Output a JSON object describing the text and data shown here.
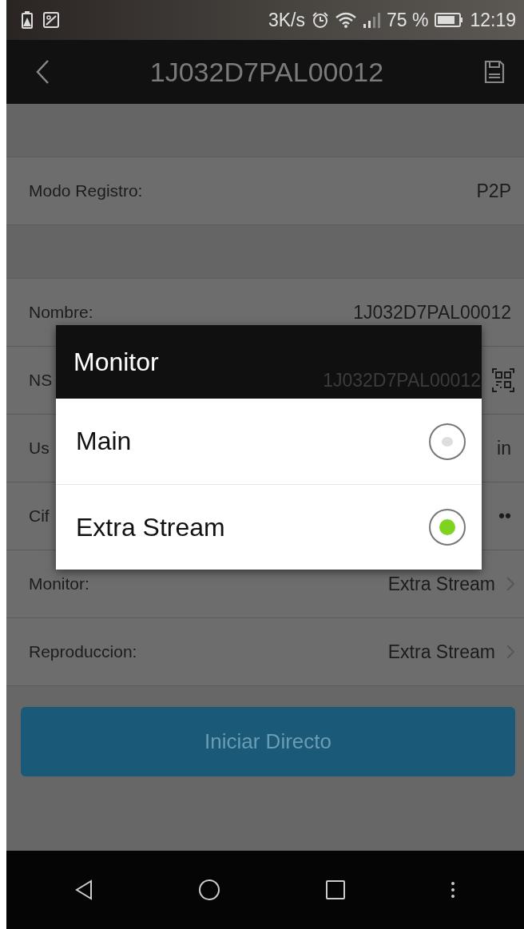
{
  "status_bar": {
    "speed": "3K/s",
    "battery": "75 %",
    "time": "12:19"
  },
  "header": {
    "title": "1J032D7PAL00012"
  },
  "sections": [
    {
      "rows": [
        {
          "kind": "text",
          "label": "Modo Registro:",
          "value": "P2P"
        }
      ]
    },
    {
      "rows": [
        {
          "kind": "text",
          "label": "Nombre:",
          "value": "1J032D7PAL00012"
        },
        {
          "kind": "qr",
          "label": "NS",
          "value": "1J032D7PAL00012"
        },
        {
          "kind": "text",
          "label": "Us",
          "value": "in"
        },
        {
          "kind": "text",
          "label": "Cif",
          "value": "••"
        },
        {
          "kind": "select",
          "label": "Monitor:",
          "value": "Extra Stream"
        },
        {
          "kind": "select",
          "label": "Reproduccion:",
          "value": "Extra Stream"
        }
      ]
    }
  ],
  "button": {
    "label": "Iniciar Directo"
  },
  "dialog": {
    "title": "Monitor",
    "options": [
      {
        "label": "Main",
        "selected": false
      },
      {
        "label": "Extra Stream",
        "selected": true
      }
    ]
  }
}
